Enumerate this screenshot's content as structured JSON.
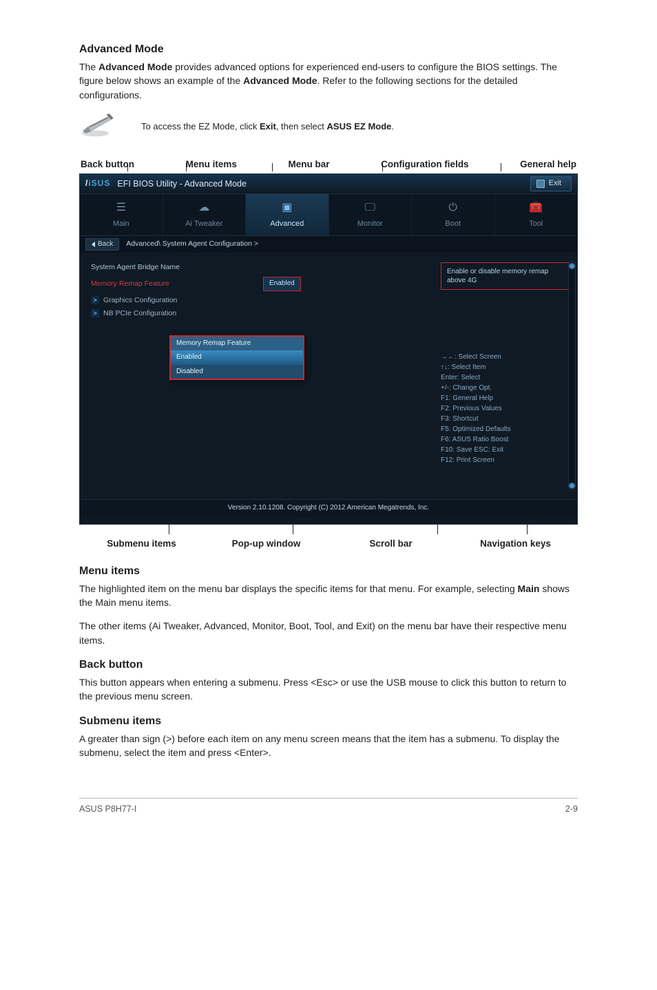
{
  "advancedMode": {
    "heading": "Advanced Mode",
    "para": "The Advanced Mode provides advanced options for experienced end-users to configure the BIOS settings. The figure below shows an example of the Advanced Mode. Refer to the following sections for the detailed configurations.",
    "note_pre": "To access the EZ Mode, click ",
    "note_b1": "Exit",
    "note_mid": ", then select ",
    "note_b2": "ASUS EZ Mode",
    "note_post": "."
  },
  "topLabels": {
    "l1": "Back button",
    "l2": "Menu items",
    "l3": "Menu bar",
    "l4": "Configuration fields",
    "l5": "General help"
  },
  "bottomLabels": {
    "l1": "Submenu items",
    "l2": "Pop-up window",
    "l3": "Scroll bar",
    "l4": "Navigation keys"
  },
  "bios": {
    "titlePrefix": "EFI BIOS Utility - Advanced Mode",
    "exit": "Exit",
    "tabs": {
      "main": "Main",
      "ai": "Ai  Tweaker",
      "adv": "Advanced",
      "mon": "Monitor",
      "boot": "Boot",
      "tool": "Tool"
    },
    "back": "Back",
    "crumb1": "Advanced\\  System Agent Configuration  >",
    "row1": "System Agent Bridge Name",
    "row2": "Memory Remap Feature",
    "row2val": "Enabled",
    "sub1": "Graphics Configuration",
    "sub2": "NB PCIe Configuration",
    "help": "Enable or disable memory remap above 4G",
    "popup": {
      "title": "Memory Remap Feature",
      "opt1": "Enabled",
      "opt2": "Disabled"
    },
    "nav": {
      "k1": "→←:  Select Screen",
      "k2": "↑↓:  Select Item",
      "k3": "Enter:  Select",
      "k4": "+/-:  Change Opt.",
      "k5": "F1:  General Help",
      "k6": "F2:  Previous Values",
      "k7": "F3:  Shortcut",
      "k8": "F5:  Optimized Defaults",
      "k9": "F6:  ASUS Ratio Boost",
      "k10": "F10:  Save   ESC:  Exit",
      "k11": "F12: Print Screen"
    },
    "version": "Version  2.10.1208.   Copyright  (C)  2012  American  Megatrends,  Inc."
  },
  "menuItems": {
    "heading": "Menu items",
    "p1a": "The highlighted item on the menu bar displays the specific items for that menu. For example, selecting ",
    "p1b": "Main",
    "p1c": " shows the Main menu items.",
    "p2": "The other items (Ai Tweaker, Advanced, Monitor, Boot, Tool, and Exit) on the menu bar have their respective menu items."
  },
  "backButton": {
    "heading": "Back button",
    "p": "This button appears when entering a submenu. Press <Esc> or use the USB mouse to click this button to return to the previous menu screen."
  },
  "submenuItems": {
    "heading": "Submenu items",
    "p": "A greater than sign (>) before each item on any menu screen means that the item has a submenu. To display the submenu, select the item and press <Enter>."
  },
  "footer": {
    "left": "ASUS P8H77-I",
    "right": "2-9"
  }
}
